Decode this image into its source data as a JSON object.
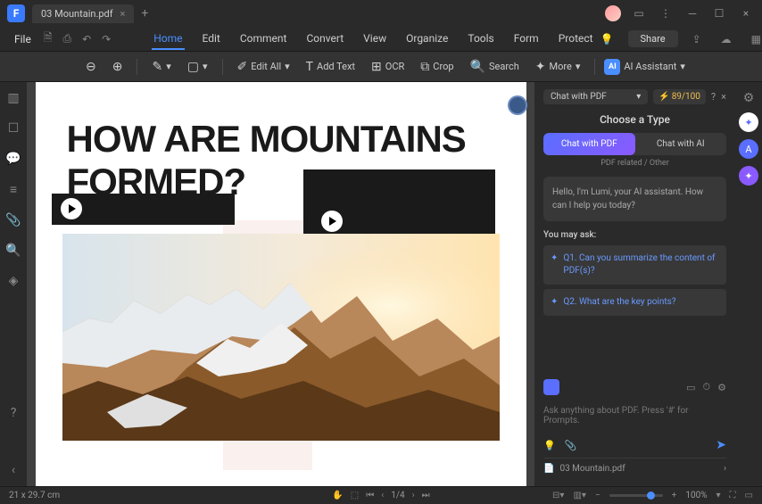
{
  "title_tab": "03 Mountain.pdf",
  "menubar": {
    "file": "File",
    "items": [
      "Home",
      "Edit",
      "Comment",
      "Convert",
      "View",
      "Organize",
      "Tools",
      "Form",
      "Protect"
    ],
    "share": "Share"
  },
  "toolbar": {
    "edit_all": "Edit All",
    "add_text": "Add Text",
    "ocr": "OCR",
    "crop": "Crop",
    "search": "Search",
    "more": "More",
    "ai": "AI Assistant"
  },
  "document": {
    "heading": "HOW ARE MOUNTAINS FORMED?"
  },
  "ai_panel": {
    "mode": "Chat with PDF",
    "credits": "89/100",
    "choose": "Choose a Type",
    "tab1": "Chat with PDF",
    "tab2": "Chat with AI",
    "subtitle": "PDF related / Other",
    "greeting": "Hello, I'm Lumi, your AI assistant. How can I help you today?",
    "you_may": "You may ask:",
    "q1": "Q1. Can you summarize the content of PDF(s)?",
    "q2": "Q2. What are the key points?",
    "input_hint": "Ask anything about PDF. Press '#' for Prompts.",
    "file_ref": "03 Mountain.pdf"
  },
  "status": {
    "dims": "21 x 29.7 cm",
    "page": "1",
    "pages": "/4",
    "zoom": "100%"
  }
}
